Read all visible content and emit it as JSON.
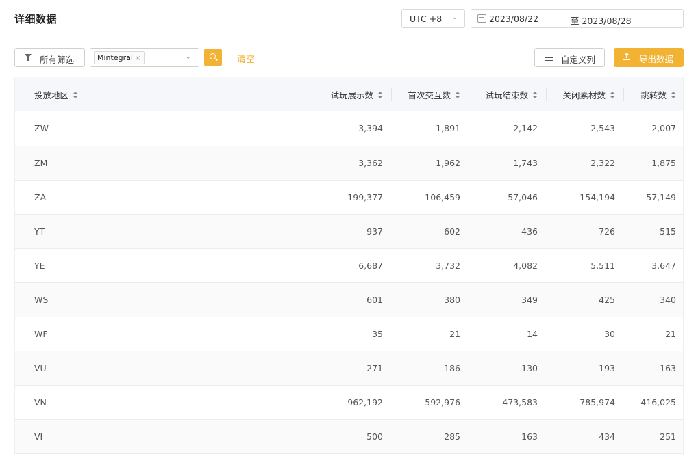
{
  "header": {
    "title": "详细数据",
    "timezone": "UTC +8",
    "date_start": "2023/08/22",
    "date_end": "至 2023/08/28"
  },
  "toolbar": {
    "filter_label": "所有筛选",
    "tag": "Mintegral",
    "tag_close": "×",
    "clear_label": "清空",
    "custom_columns_label": "自定义列",
    "export_label": "导出数据"
  },
  "table": {
    "columns": [
      "投放地区",
      "试玩展示数",
      "首次交互数",
      "试玩结束数",
      "关闭素材数",
      "跳转数"
    ],
    "rows": [
      [
        "ZW",
        "3,394",
        "1,891",
        "2,142",
        "2,543",
        "2,007"
      ],
      [
        "ZM",
        "3,362",
        "1,962",
        "1,743",
        "2,322",
        "1,875"
      ],
      [
        "ZA",
        "199,377",
        "106,459",
        "57,046",
        "154,194",
        "57,149"
      ],
      [
        "YT",
        "937",
        "602",
        "436",
        "726",
        "515"
      ],
      [
        "YE",
        "6,687",
        "3,732",
        "4,082",
        "5,511",
        "3,647"
      ],
      [
        "WS",
        "601",
        "380",
        "349",
        "425",
        "340"
      ],
      [
        "WF",
        "35",
        "21",
        "14",
        "30",
        "21"
      ],
      [
        "VU",
        "271",
        "186",
        "130",
        "193",
        "163"
      ],
      [
        "VN",
        "962,192",
        "592,976",
        "473,583",
        "785,974",
        "416,025"
      ],
      [
        "VI",
        "500",
        "285",
        "163",
        "434",
        "251"
      ]
    ]
  },
  "icons": {
    "chevron": "chevron-down-icon",
    "calendar": "calendar-icon",
    "filter": "filter-icon",
    "search": "search-icon",
    "columns": "list-icon",
    "export": "upload-icon",
    "sort": "sort-icon"
  },
  "colors": {
    "accent": "#f2b233",
    "header_bg": "#f5f7fa"
  }
}
